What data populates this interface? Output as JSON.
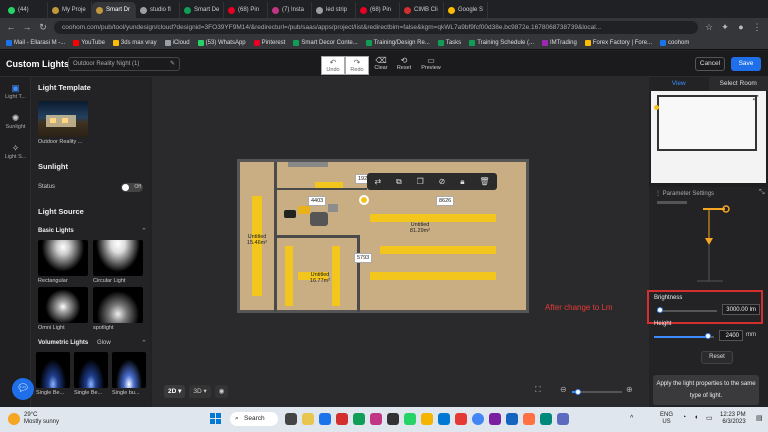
{
  "browser": {
    "tabs": [
      {
        "label": "(44)",
        "color": "#25d366"
      },
      {
        "label": "My Proje",
        "color": "#c2983a"
      },
      {
        "label": "Smart Dr",
        "color": "#c2983a",
        "active": true
      },
      {
        "label": "studio fl",
        "color": "#9aa0a6"
      },
      {
        "label": "Smart De",
        "color": "#0f9d58"
      },
      {
        "label": "(68) Pin",
        "color": "#e60023"
      },
      {
        "label": "(7) Insta",
        "color": "#c13584"
      },
      {
        "label": "led strip",
        "color": "#9aa0a6"
      },
      {
        "label": "(68) Pin",
        "color": "#e60023"
      },
      {
        "label": "CIMB Cli",
        "color": "#d32f2f"
      },
      {
        "label": "Google S",
        "color": "#fbbc04"
      }
    ],
    "url": "coohom.com/pub/tool/yundesign/cloud?designid=3FO39YF9M14/&redirecturl=/pub/saas/apps/project/list&redirectbim=false&kgm=qkWL7a9bf9fcf00d38e.bc9872e.1678068738739&local...",
    "bookmarks": [
      {
        "label": "Mail - Ellarasi M -...",
        "color": "#1a73e8"
      },
      {
        "label": "YouTube",
        "color": "#ff0000"
      },
      {
        "label": "3ds max vray",
        "color": "#fbbc04"
      },
      {
        "label": "iCloud",
        "color": "#9aa0a6"
      },
      {
        "label": "(53) WhatsApp",
        "color": "#25d366"
      },
      {
        "label": "Pinterest",
        "color": "#e60023"
      },
      {
        "label": "Smart Decor Conte...",
        "color": "#0f9d58"
      },
      {
        "label": "Training/Design Re...",
        "color": "#0f9d58"
      },
      {
        "label": "Tasks",
        "color": "#0f9d58"
      },
      {
        "label": "Training Schedule (...",
        "color": "#0f9d58"
      },
      {
        "label": "IMTrading",
        "color": "#9c27b0"
      },
      {
        "label": "Forex Factory | Fore...",
        "color": "#fbbc04"
      },
      {
        "label": "coohom",
        "color": "#1a73e8"
      }
    ]
  },
  "app": {
    "title": "Custom Lights",
    "design_name": "Outdoor Reality Night (1)",
    "toolbar": {
      "undo": "Undo",
      "redo": "Redo",
      "clear": "Clear",
      "reset": "Reset",
      "preview": "Preview"
    },
    "cancel": "Cancel",
    "save": "Save"
  },
  "iconbar": [
    {
      "label": "Light T...",
      "icon": "bulb-icon",
      "active": true
    },
    {
      "label": "Sunlight",
      "icon": "sun-icon"
    },
    {
      "label": "Light S...",
      "icon": "light-source-icon"
    }
  ],
  "left_panel": {
    "light_template_heading": "Light Template",
    "template_caption": "Outdoor Reality ...",
    "sunlight_heading": "Sunlight",
    "status_label": "Status",
    "status_value": "Off",
    "light_source_heading": "Light Source",
    "basic_lights_heading": "Basic Lights",
    "basic_lights": [
      "Rectangular",
      "Circular Light",
      "Omni Light",
      "spotlight"
    ],
    "volumetric_heading": "Volumetric Lights",
    "glow_label": "Glow",
    "volumetric": [
      "Single Be...",
      "Single Be...",
      "Single bu..."
    ]
  },
  "canvas": {
    "rooms": [
      {
        "name": "Untitled",
        "area": "15.46m²"
      },
      {
        "name": "Untitled",
        "area": "81.29m²"
      },
      {
        "name": "Untitled",
        "area": "16.77m²"
      }
    ],
    "dims": [
      "1926",
      "4403",
      "8626",
      "5793"
    ],
    "view_2d": "2D",
    "view_3d": "3D",
    "annotation": "After  change to Lm"
  },
  "right_panel": {
    "tab_view": "View",
    "tab_select_room": "Select Room",
    "param_title": "Parameter Settings",
    "brightness_label": "Brightness",
    "brightness_value": "3000.00",
    "brightness_unit": "lm",
    "height_label": "Height",
    "height_value": "2400",
    "height_unit": "mm",
    "reset": "Reset",
    "apply": "Apply the light properties to the same type of light.",
    "brightness_slider": 0.05,
    "height_slider": 0.9
  },
  "taskbar": {
    "temp": "29°C",
    "weather": "Mostly sunny",
    "search": "Search",
    "lang": "ENG",
    "region": "US",
    "time": "12:23 PM",
    "date": "6/3/2023"
  }
}
